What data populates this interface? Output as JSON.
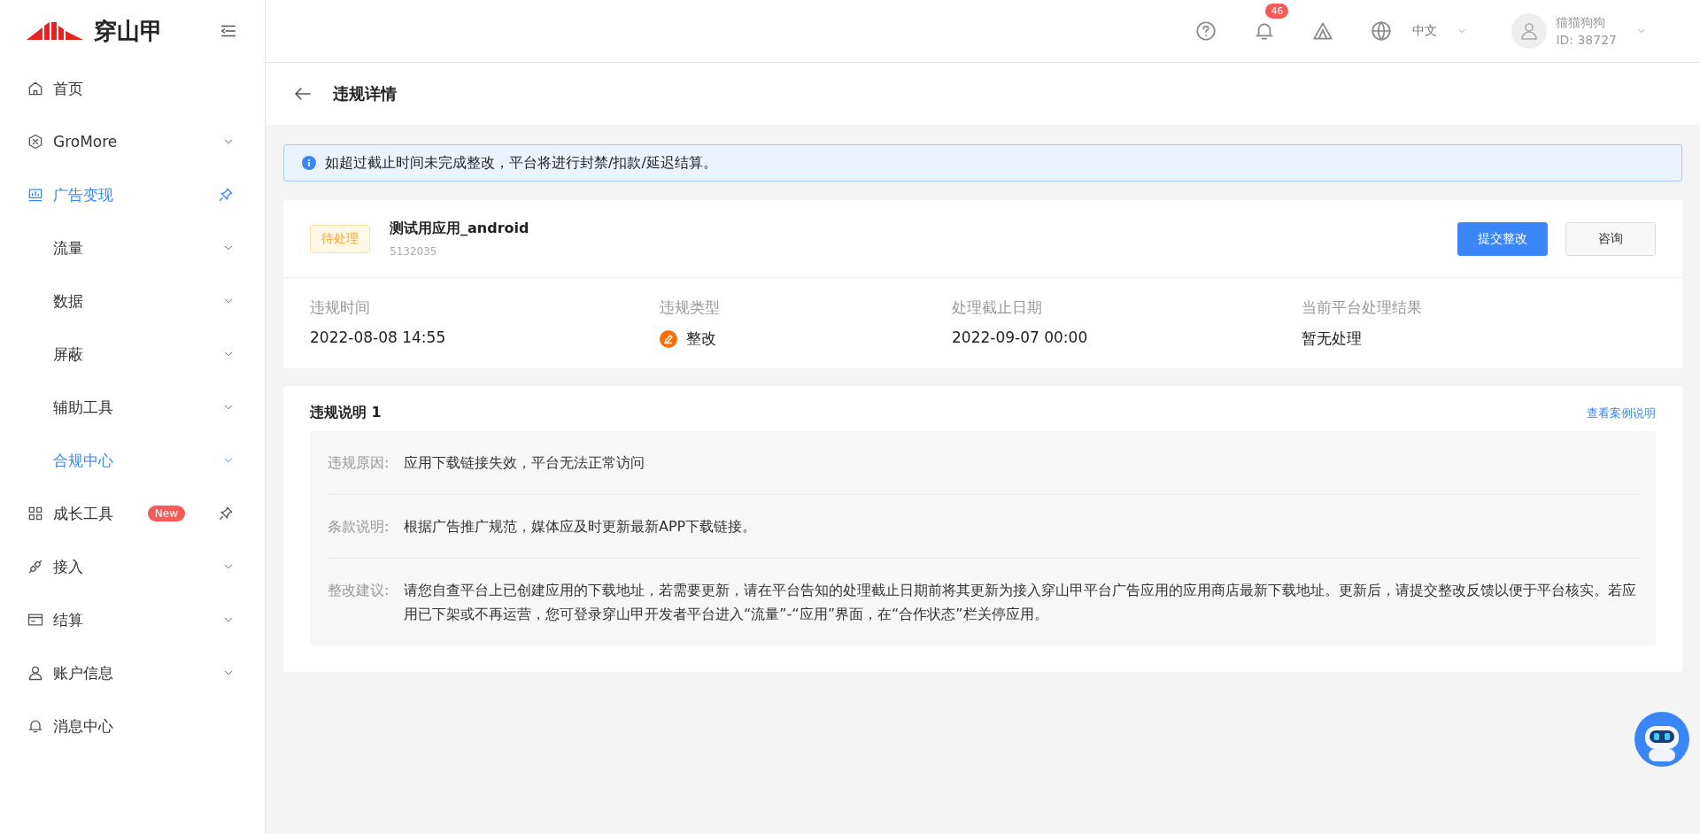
{
  "logo": {
    "text": "穿山甲"
  },
  "sidebar": {
    "items": [
      {
        "label": "首页",
        "selected": false,
        "expandable": false,
        "pinned": false
      },
      {
        "label": "GroMore",
        "selected": false,
        "expandable": true,
        "pinned": false
      },
      {
        "label": "广告变现",
        "selected": true,
        "expandable": false,
        "pinned": true,
        "children": [
          {
            "label": "流量",
            "selected": false
          },
          {
            "label": "数据",
            "selected": false
          },
          {
            "label": "屏蔽",
            "selected": false
          },
          {
            "label": "辅助工具",
            "selected": false
          },
          {
            "label": "合规中心",
            "selected": true
          }
        ]
      },
      {
        "label": "成长工具",
        "selected": false,
        "expandable": false,
        "pinned": true,
        "badge": "New"
      },
      {
        "label": "接入",
        "selected": false,
        "expandable": true,
        "pinned": false
      },
      {
        "label": "结算",
        "selected": false,
        "expandable": true,
        "pinned": false
      },
      {
        "label": "账户信息",
        "selected": false,
        "expandable": true,
        "pinned": false
      },
      {
        "label": "消息中心",
        "selected": false,
        "expandable": false,
        "pinned": false
      }
    ]
  },
  "topbar": {
    "notification_count": "46",
    "language": "中文",
    "user": {
      "name": "猫猫狗狗",
      "id": "ID: 38727"
    }
  },
  "page": {
    "title": "违规详情"
  },
  "alert": {
    "text": "如超过截止时间未完成整改，平台将进行封禁/扣款/延迟结算。"
  },
  "app": {
    "status": "待处理",
    "name": "测试用应用_android",
    "app_id": "5132035",
    "buttons": [
      {
        "label": "提交整改",
        "kind": "primary"
      },
      {
        "label": "咨询",
        "kind": "default"
      }
    ],
    "fields": [
      {
        "label": "违规时间",
        "value": "2022-08-08 14:55"
      },
      {
        "label": "违规类型",
        "value": "整改",
        "kind": "tag"
      },
      {
        "label": "处理截止日期",
        "value": "2022-09-07 00:00"
      },
      {
        "label": "当前平台处理结果",
        "value": "暂无处理"
      }
    ]
  },
  "explanation": {
    "title": "违规说明 1",
    "link": "查看案例说明",
    "rows": [
      {
        "label": "违规原因:",
        "text": "应用下载链接失效，平台无法正常访问"
      },
      {
        "label": "条款说明:",
        "text": "根据广告推广规范，媒体应及时更新最新APP下载链接。"
      },
      {
        "label": "整改建议:",
        "text": "请您自查平台上已创建应用的下载地址，若需要更新，请在平台告知的处理截止日期前将其更新为接入穿山甲平台广告应用的应用商店最新下载地址。更新后，请提交整改反馈以便于平台核实。若应用已下架或不再运营，您可登录穿山甲开发者平台进入“流量”-“应用”界面，在“合作状态”栏关停应用。"
      }
    ]
  }
}
